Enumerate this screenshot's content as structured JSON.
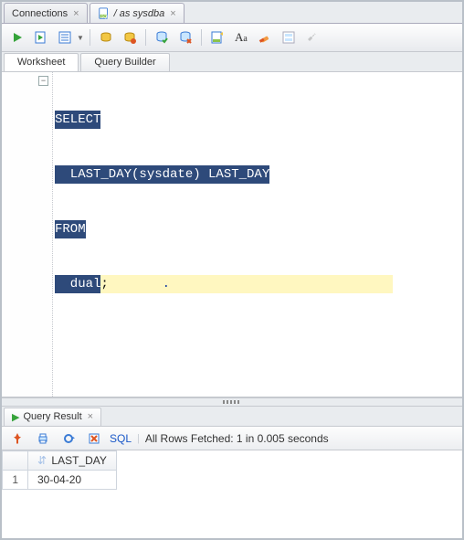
{
  "tabs": {
    "connections": "Connections",
    "worksheet": "/ as sysdba"
  },
  "subtabs": {
    "worksheet": "Worksheet",
    "query_builder": "Query Builder"
  },
  "sql": {
    "line1": "SELECT",
    "line2": "  LAST_DAY(sysdate) LAST_DAY",
    "line3": "FROM",
    "line4a": "  dual",
    "line4b": ";"
  },
  "results": {
    "tab_label": "Query Result",
    "sql_link": "SQL",
    "status": "All Rows Fetched: 1 in 0.005 seconds",
    "columns": [
      "LAST_DAY"
    ],
    "rows": [
      {
        "n": "1",
        "LAST_DAY": "30-04-20"
      }
    ]
  }
}
